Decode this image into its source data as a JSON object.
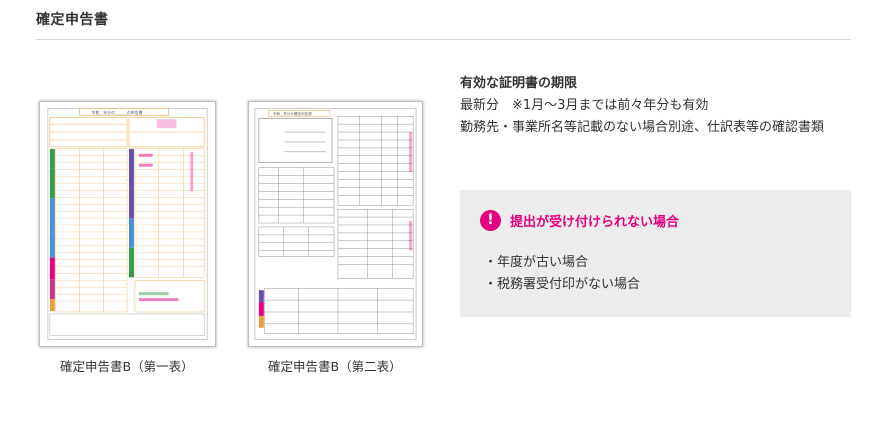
{
  "header": {
    "title": "確定申告書"
  },
  "documents": [
    {
      "caption": "確定申告書B（第一表）",
      "form_title": "令和＿年分の＿＿＿の申告書"
    },
    {
      "caption": "確定申告書B（第二表）",
      "form_title": "令和＿年分の確定申告書"
    }
  ],
  "info": {
    "title": "有効な証明書の期限",
    "lines": [
      "最新分　※1月～3月までは前々年分も有効",
      "勤務先・事業所名等記載のない場合別途、仕訳表等の確認書類"
    ]
  },
  "warning": {
    "icon": "exclamation-icon",
    "title": "提出が受け付けられない場合",
    "items": [
      "年度が古い場合",
      "税務署受付印がない場合"
    ],
    "accent_color": "#e4007f"
  }
}
